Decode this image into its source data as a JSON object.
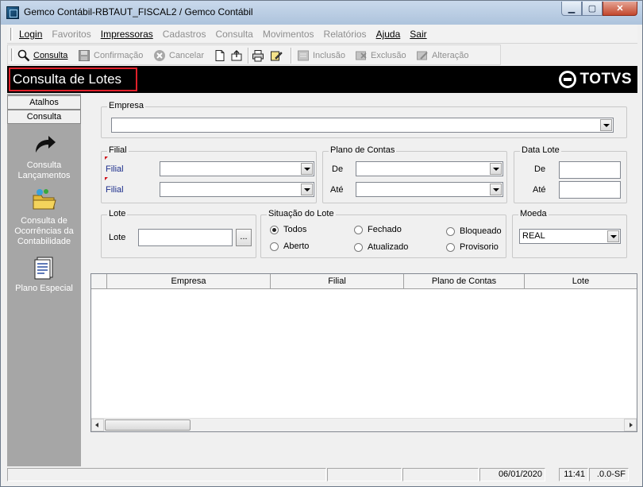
{
  "window": {
    "title": "Gemco Contábil-RBTAUT_FISCAL2 / Gemco Contábil",
    "controls": {
      "minimize": "▁",
      "maximize": "▢",
      "close": "✕"
    }
  },
  "menubar": {
    "items": [
      {
        "label": "Login",
        "enabled": true
      },
      {
        "label": "Favoritos",
        "enabled": false
      },
      {
        "label": "Impressoras",
        "enabled": true
      },
      {
        "label": "Cadastros",
        "enabled": false
      },
      {
        "label": "Consulta",
        "enabled": false
      },
      {
        "label": "Movimentos",
        "enabled": false
      },
      {
        "label": "Relatórios",
        "enabled": false
      },
      {
        "label": "Ajuda",
        "enabled": true
      },
      {
        "label": "Sair",
        "enabled": true
      }
    ]
  },
  "toolbar": {
    "consulta": "Consulta",
    "confirmacao": "Confirmação",
    "cancelar": "Cancelar",
    "inclusao": "Inclusão",
    "exclusao": "Exclusão",
    "alteracao": "Alteração",
    "icons": [
      "search-icon",
      "save-icon",
      "cancel-icon",
      "new-document-icon",
      "export-icon",
      "print-icon",
      "edit-icon",
      "add-icon",
      "delete-icon",
      "alter-icon"
    ]
  },
  "header": {
    "title": "Consulta de Lotes",
    "brand": "TOTVS",
    "colors": {
      "background": "#000000",
      "highlight_border": "#e0202a"
    }
  },
  "sidebar": {
    "tabs": [
      "Atalhos",
      "Consulta"
    ],
    "items": [
      {
        "label": "Consulta Lançamentos",
        "icon": "arrow-icon"
      },
      {
        "label": "Consulta de Ocorrências da Contabilidade",
        "icon": "folder-icon"
      },
      {
        "label": "Plano Especial",
        "icon": "document-icon"
      }
    ]
  },
  "form": {
    "empresa": {
      "title": "Empresa",
      "value": ""
    },
    "filial": {
      "title": "Filial",
      "label1": "Filial",
      "label2": "Filial",
      "value1": "",
      "value2": ""
    },
    "plano": {
      "title": "Plano de Contas",
      "de": "De",
      "ate": "Até",
      "value_de": "",
      "value_ate": ""
    },
    "data_lote": {
      "title": "Data Lote",
      "de": "De",
      "ate": "Até",
      "value_de": "",
      "value_ate": ""
    },
    "lote": {
      "title": "Lote",
      "label": "Lote",
      "value": "",
      "lookup_label": "..."
    },
    "situacao": {
      "title": "Situação do Lote",
      "options": [
        "Todos",
        "Fechado",
        "Bloqueado",
        "Aberto",
        "Atualizado",
        "Provisorio"
      ],
      "selected": "Todos"
    },
    "moeda": {
      "title": "Moeda",
      "value": "REAL"
    }
  },
  "grid": {
    "columns": [
      "Empresa",
      "Filial",
      "Plano de Contas",
      "Lote"
    ],
    "rows": []
  },
  "statusbar": {
    "date": "06/01/2020",
    "time": "11:41",
    "version": ".0.0-SF"
  }
}
